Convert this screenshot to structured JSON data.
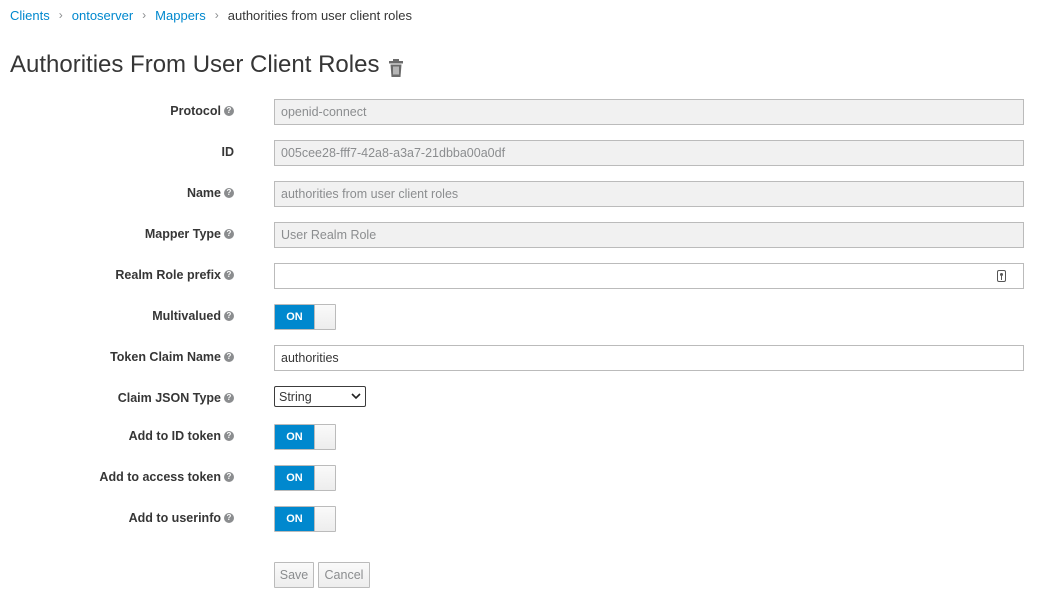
{
  "breadcrumb": {
    "clients": "Clients",
    "client": "ontoserver",
    "mappers": "Mappers",
    "current": "authorities from user client roles",
    "separator": "›"
  },
  "page": {
    "title": "Authorities From User Client Roles"
  },
  "form": {
    "protocol": {
      "label": "Protocol",
      "value": "openid-connect"
    },
    "id": {
      "label": "ID",
      "value": "005cee28-fff7-42a8-a3a7-21dbba00a0df"
    },
    "name": {
      "label": "Name",
      "value": "authorities from user client roles"
    },
    "mapper_type": {
      "label": "Mapper Type",
      "value": "User Realm Role"
    },
    "realm_role_prefix": {
      "label": "Realm Role prefix",
      "value": ""
    },
    "multivalued": {
      "label": "Multivalued",
      "state": "ON"
    },
    "token_claim_name": {
      "label": "Token Claim Name",
      "value": "authorities"
    },
    "claim_json_type": {
      "label": "Claim JSON Type",
      "value": "String"
    },
    "add_to_id_token": {
      "label": "Add to ID token",
      "state": "ON"
    },
    "add_to_access_token": {
      "label": "Add to access token",
      "state": "ON"
    },
    "add_to_userinfo": {
      "label": "Add to userinfo",
      "state": "ON"
    }
  },
  "help_glyph": "?",
  "actions": {
    "save": "Save",
    "cancel": "Cancel"
  },
  "icons": {
    "delete": "trash-icon",
    "help": "help-icon",
    "key": "key-icon",
    "dropdown": "chevron-down-icon"
  },
  "colors": {
    "accent": "#0088ce",
    "readonly_bg": "#f1f1f1",
    "border": "#bbbbbb"
  }
}
